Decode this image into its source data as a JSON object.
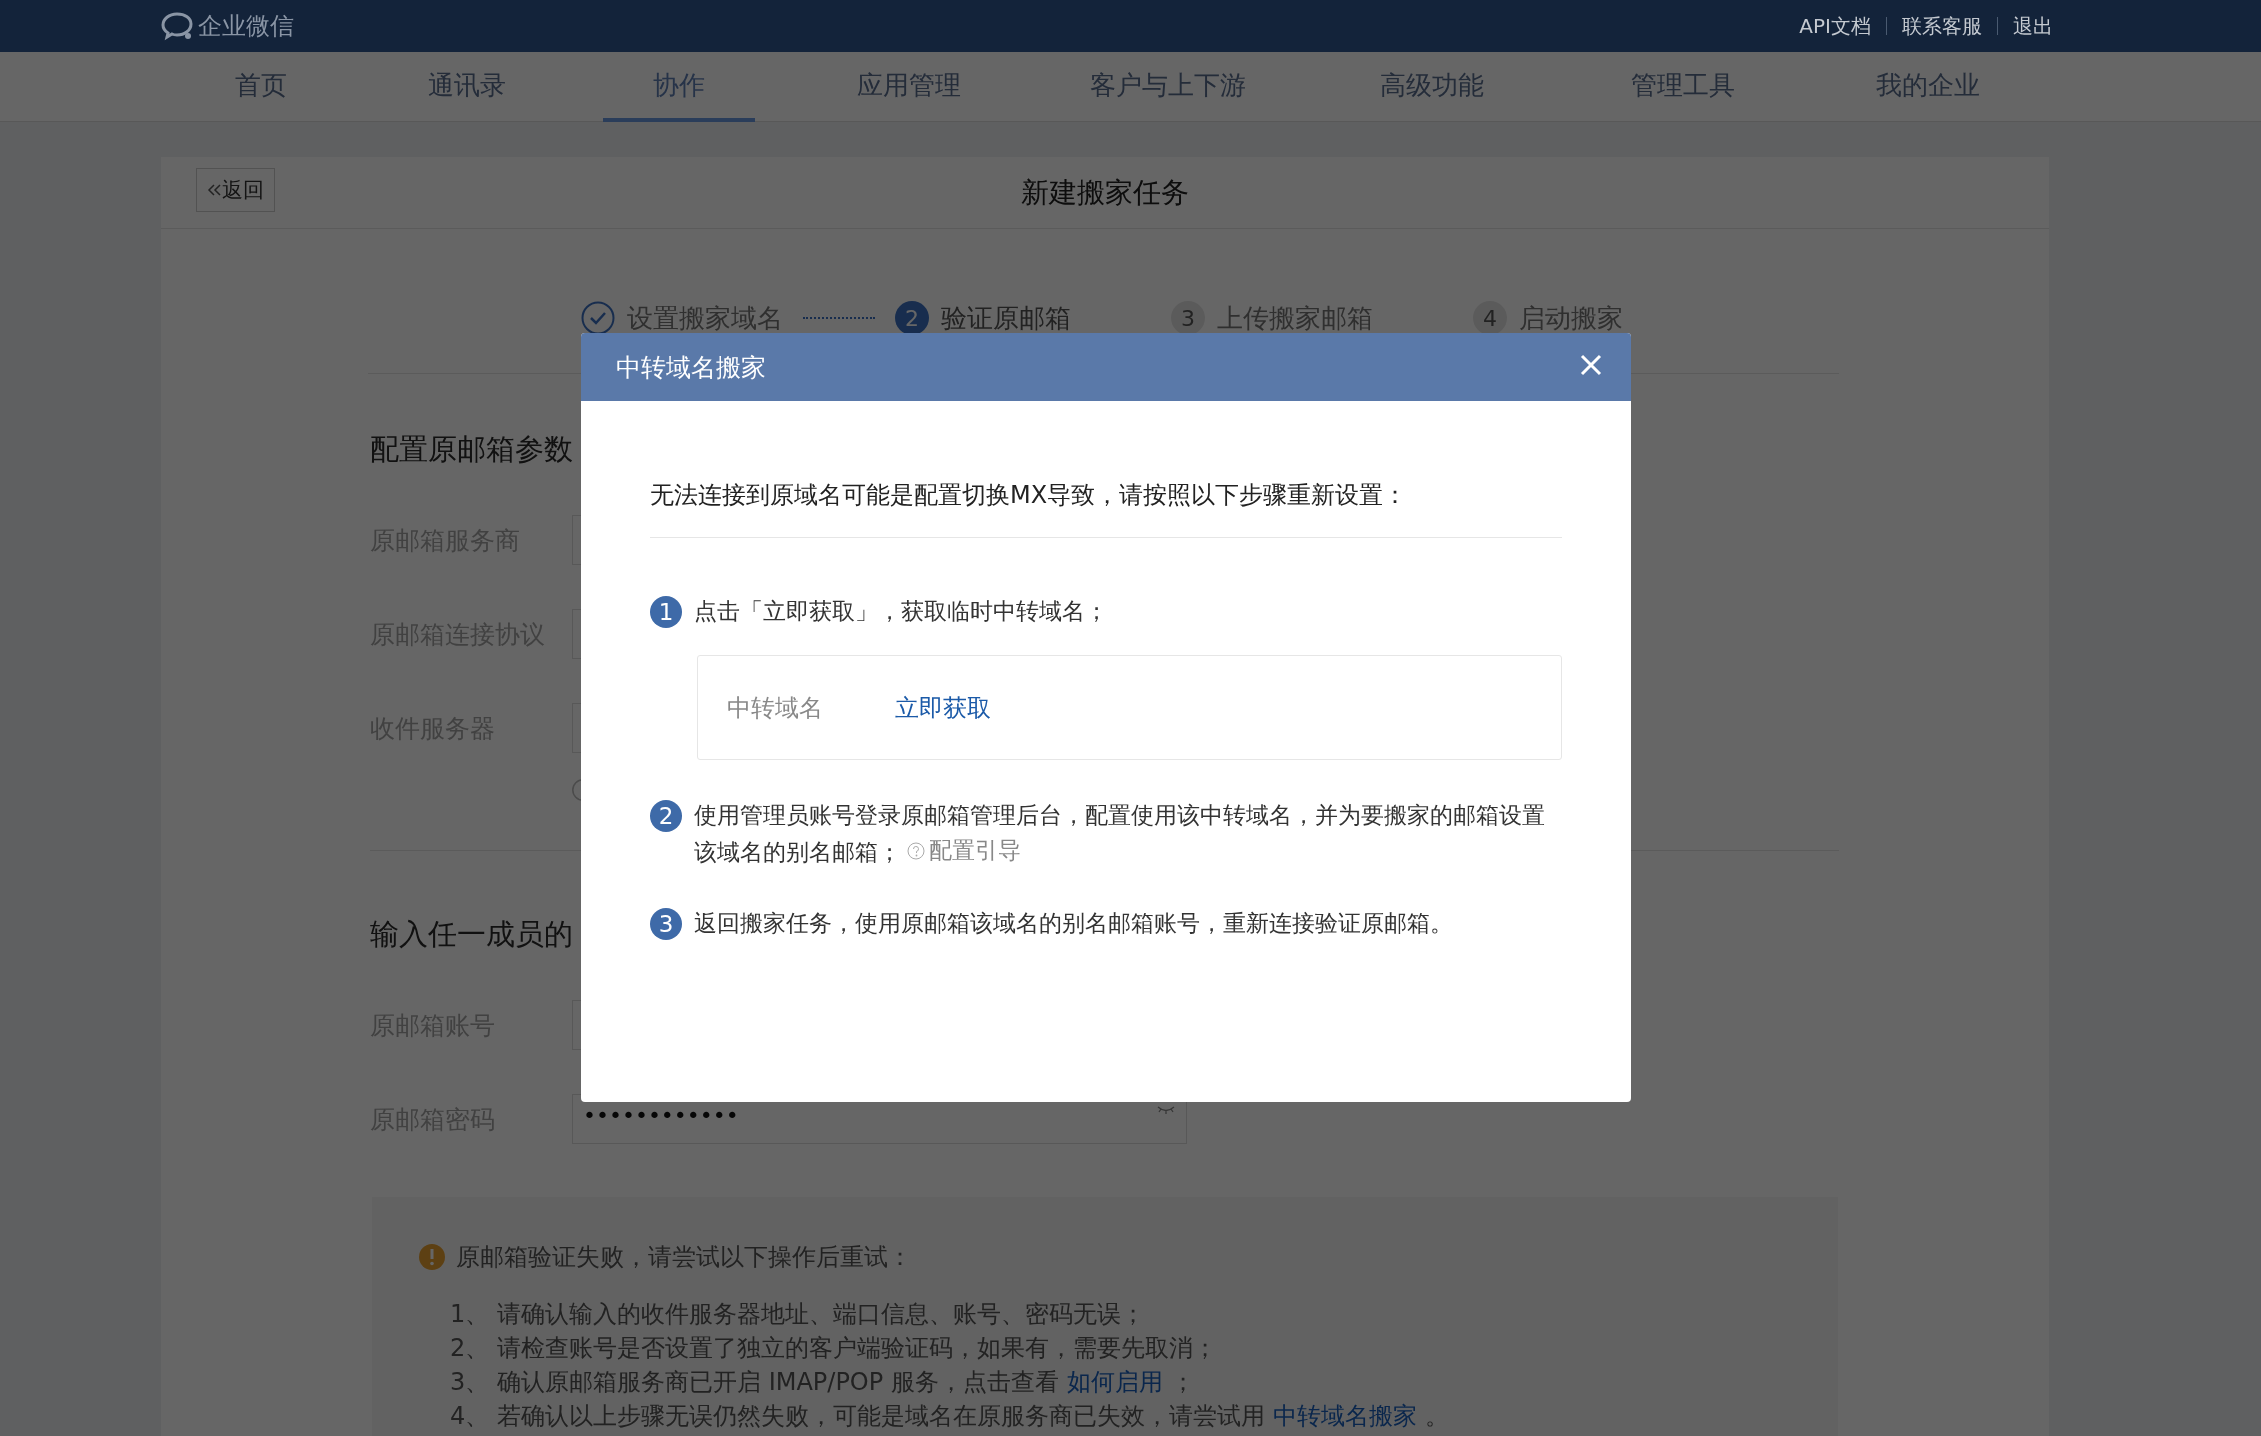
{
  "header": {
    "logo_text": "企业微信",
    "links": [
      "API文档",
      "联系客服",
      "退出"
    ]
  },
  "nav": [
    {
      "label": "首页",
      "selected": false
    },
    {
      "label": "通讯录",
      "selected": false
    },
    {
      "label": "协作",
      "selected": true
    },
    {
      "label": "应用管理",
      "selected": false
    },
    {
      "label": "客户与上下游",
      "selected": false
    },
    {
      "label": "高级功能",
      "selected": false
    },
    {
      "label": "管理工具",
      "selected": false
    },
    {
      "label": "我的企业",
      "selected": false
    }
  ],
  "page": {
    "back": "返回",
    "title": "新建搬家任务"
  },
  "steps": [
    {
      "label": "设置搬家域名",
      "done": true,
      "selected": false
    },
    {
      "number": "2",
      "label": "验证原邮箱",
      "done": false,
      "selected": true
    },
    {
      "number": "3",
      "label": "上传搬家邮箱",
      "done": false,
      "selected": false
    },
    {
      "number": "4",
      "label": "启动搬家",
      "done": false,
      "selected": false
    }
  ],
  "section_1": {
    "title": "配置原邮箱参数",
    "fields": [
      {
        "label": "原邮箱服务商"
      },
      {
        "label": "原邮箱连接协议"
      },
      {
        "label": "收件服务器"
      }
    ]
  },
  "section_2": {
    "title": "输入任一成员的",
    "fields": [
      {
        "label": "原邮箱账号"
      },
      {
        "label": "原邮箱密码",
        "kind": "password",
        "value": "••••••••••••"
      }
    ]
  },
  "notice": {
    "title": "原邮箱验证失败，请尝试以下操作后重试：",
    "items": [
      {
        "number": "1、",
        "text": "请确认输入的收件服务器地址、端口信息、账号、密码无误；"
      },
      {
        "number": "2、",
        "text": "请检查账号是否设置了独立的客户端验证码，如果有，需要先取消；"
      },
      {
        "number": "3、",
        "text": "确认原邮箱服务商已开启 IMAP/POP 服务，点击查看",
        "link": "如何启用",
        "after": "；"
      },
      {
        "number": "4、",
        "text": "若确认以上步骤无误仍然失败，可能是域名在原服务商已失效，请尝试用",
        "link": "中转域名搬家",
        "after": "。"
      }
    ]
  },
  "modal": {
    "title": "中转域名搬家",
    "intro": "无法连接到原域名可能是配置切换MX导致，请按照以下步骤重新设置：",
    "steps": [
      {
        "number": "1",
        "text": "点击「立即获取」，获取临时中转域名；",
        "relay": {
          "label": "中转域名",
          "action": "立即获取"
        }
      },
      {
        "number": "2",
        "text": "使用管理员账号登录原邮箱管理后台，配置使用该中转域名，并为要搬家的邮箱设置该域名的别名邮箱；",
        "help": "配置引导"
      },
      {
        "number": "3",
        "text": "返回搬家任务，使用原邮箱该域名的别名邮箱账号，重新连接验证原邮箱。"
      }
    ]
  }
}
